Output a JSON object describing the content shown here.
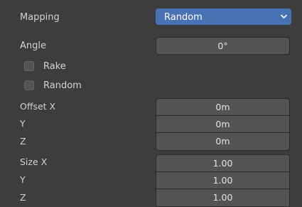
{
  "mapping": {
    "label": "Mapping",
    "value": "Random"
  },
  "angle": {
    "label": "Angle",
    "value": "0°"
  },
  "checkboxes": [
    {
      "label": "Rake",
      "checked": false
    },
    {
      "label": "Random",
      "checked": false
    }
  ],
  "offset": {
    "x_label": "Offset X",
    "x_value": "0m",
    "y_label": "Y",
    "y_value": "0m",
    "z_label": "Z",
    "z_value": "0m"
  },
  "size": {
    "x_label": "Size X",
    "x_value": "1.00",
    "y_label": "Y",
    "y_value": "1.00",
    "z_label": "Z",
    "z_value": "1.00"
  },
  "colors": {
    "background": "#3d3d3d",
    "field": "#545454",
    "dropdown_accent": "#4772b3"
  }
}
